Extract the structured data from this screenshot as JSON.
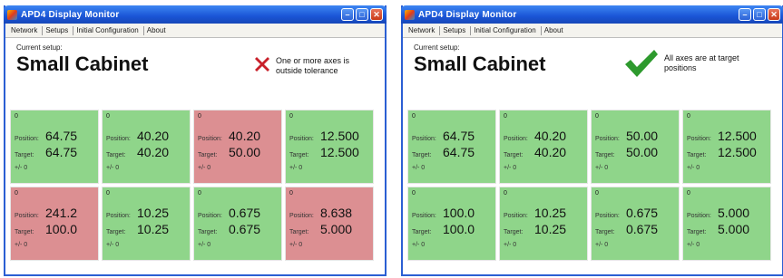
{
  "windows": [
    {
      "title": "APD4 Display Monitor",
      "menu": [
        "Network",
        "Setups",
        "Initial Configuration",
        "About"
      ],
      "current_setup_label": "Current setup:",
      "setup_name": "Small Cabinet",
      "status_icon": "red-x-icon",
      "status_text": "One or more axes is outside tolerance",
      "tiles": [
        {
          "idx": "0",
          "position_label": "Position:",
          "position": "64.75",
          "target_label": "Target:",
          "target": "64.75",
          "tol": "+/- 0",
          "state": "ok"
        },
        {
          "idx": "0",
          "position_label": "Position:",
          "position": "40.20",
          "target_label": "Target:",
          "target": "40.20",
          "tol": "+/- 0",
          "state": "ok"
        },
        {
          "idx": "0",
          "position_label": "Position:",
          "position": "40.20",
          "target_label": "Target:",
          "target": "50.00",
          "tol": "+/- 0",
          "state": "bad"
        },
        {
          "idx": "0",
          "position_label": "Position:",
          "position": "12.500",
          "target_label": "Target:",
          "target": "12.500",
          "tol": "+/- 0",
          "state": "ok"
        },
        {
          "idx": "0",
          "position_label": "Position:",
          "position": "241.2",
          "target_label": "Target:",
          "target": "100.0",
          "tol": "+/- 0",
          "state": "bad"
        },
        {
          "idx": "0",
          "position_label": "Position:",
          "position": "10.25",
          "target_label": "Target:",
          "target": "10.25",
          "tol": "+/- 0",
          "state": "ok"
        },
        {
          "idx": "0",
          "position_label": "Position:",
          "position": "0.675",
          "target_label": "Target:",
          "target": "0.675",
          "tol": "+/- 0",
          "state": "ok"
        },
        {
          "idx": "0",
          "position_label": "Position:",
          "position": "8.638",
          "target_label": "Target:",
          "target": "5.000",
          "tol": "+/- 0",
          "state": "bad"
        }
      ]
    },
    {
      "title": "APD4 Display Monitor",
      "menu": [
        "Network",
        "Setups",
        "Initial Configuration",
        "About"
      ],
      "current_setup_label": "Current setup:",
      "setup_name": "Small Cabinet",
      "status_icon": "green-checkmark-icon",
      "status_text": "All axes are at target positions",
      "tiles": [
        {
          "idx": "0",
          "position_label": "Position:",
          "position": "64.75",
          "target_label": "Target:",
          "target": "64.75",
          "tol": "+/- 0",
          "state": "ok"
        },
        {
          "idx": "0",
          "position_label": "Position:",
          "position": "40.20",
          "target_label": "Target:",
          "target": "40.20",
          "tol": "+/- 0",
          "state": "ok"
        },
        {
          "idx": "0",
          "position_label": "Position:",
          "position": "50.00",
          "target_label": "Target:",
          "target": "50.00",
          "tol": "+/- 0",
          "state": "ok"
        },
        {
          "idx": "0",
          "position_label": "Position:",
          "position": "12.500",
          "target_label": "Target:",
          "target": "12.500",
          "tol": "+/- 0",
          "state": "ok"
        },
        {
          "idx": "0",
          "position_label": "Position:",
          "position": "100.0",
          "target_label": "Target:",
          "target": "100.0",
          "tol": "+/- 0",
          "state": "ok"
        },
        {
          "idx": "0",
          "position_label": "Position:",
          "position": "10.25",
          "target_label": "Target:",
          "target": "10.25",
          "tol": "+/- 0",
          "state": "ok"
        },
        {
          "idx": "0",
          "position_label": "Position:",
          "position": "0.675",
          "target_label": "Target:",
          "target": "0.675",
          "tol": "+/- 0",
          "state": "ok"
        },
        {
          "idx": "0",
          "position_label": "Position:",
          "position": "5.000",
          "target_label": "Target:",
          "target": "5.000",
          "tol": "+/- 0",
          "state": "ok"
        }
      ]
    }
  ],
  "colors": {
    "ok": "#8fd58a",
    "bad": "#dc8f92",
    "title_bar": "#1a55d6"
  }
}
